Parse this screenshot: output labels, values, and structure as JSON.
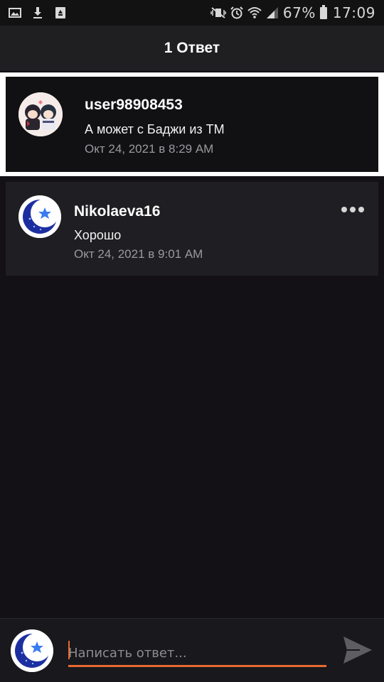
{
  "status_bar": {
    "battery": "67%",
    "time": "17:09",
    "left_icons": [
      "image-icon",
      "download-icon",
      "recycle-icon"
    ],
    "right_icons": [
      "mute-vibrate-icon",
      "alarm-icon",
      "wifi-icon",
      "signal-icon",
      "battery-icon"
    ]
  },
  "header": {
    "title": "1 Ответ"
  },
  "parent_comment": {
    "username": "user98908453",
    "text": "А может с Баджи из ТМ",
    "timestamp": "Окт 24, 2021 в 8:29 AM",
    "avatar": "anime-couple-avatar"
  },
  "reply": {
    "username": "Nikolaeva16",
    "text": "Хорошо",
    "timestamp": "Окт 24, 2021 в 9:01 AM",
    "avatar": "moon-star-avatar",
    "menu_icon": "more-horizontal-icon"
  },
  "composer": {
    "placeholder": "Написать ответ...",
    "value": "",
    "send_icon": "send-icon",
    "avatar": "moon-star-avatar"
  },
  "colors": {
    "background": "#131115",
    "header": "#1f1f21",
    "accent": "#e86a2f",
    "card": "#1f1e22"
  }
}
